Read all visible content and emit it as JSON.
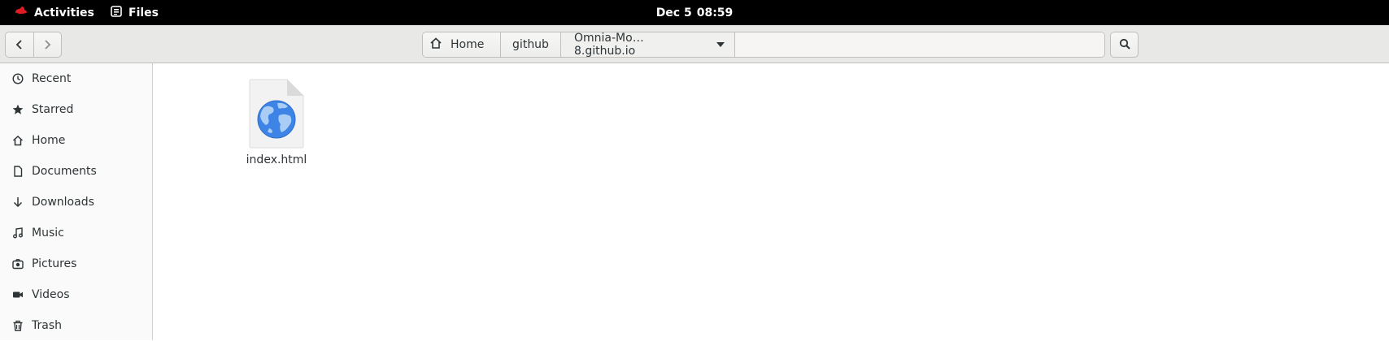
{
  "topbar": {
    "activities_label": "Activities",
    "app_name": "Files",
    "date": "Dec 5",
    "time": "08:59"
  },
  "header": {
    "back_icon": "chevron-left-icon",
    "forward_icon": "chevron-right-icon",
    "search_icon": "search-icon",
    "breadcrumb": {
      "home": "Home",
      "github": "github",
      "current": "Omnia-Mo… 8.github.io"
    }
  },
  "sidebar": {
    "items": [
      {
        "label": "Recent",
        "icon": "clock-icon"
      },
      {
        "label": "Starred",
        "icon": "star-icon"
      },
      {
        "label": "Home",
        "icon": "home-icon"
      },
      {
        "label": "Documents",
        "icon": "document-icon"
      },
      {
        "label": "Downloads",
        "icon": "download-icon"
      },
      {
        "label": "Music",
        "icon": "music-icon"
      },
      {
        "label": "Pictures",
        "icon": "camera-icon"
      },
      {
        "label": "Videos",
        "icon": "video-icon"
      },
      {
        "label": "Trash",
        "icon": "trash-icon"
      }
    ]
  },
  "files": [
    {
      "name": "index.html",
      "icon": "html-file-globe-icon"
    }
  ],
  "colors": {
    "topbar_bg": "#000000",
    "header_bg": "#e8e8e7",
    "sidebar_bg": "#fafafa",
    "globe_blue": "#3d84e6",
    "brand_red": "#e01b24"
  }
}
